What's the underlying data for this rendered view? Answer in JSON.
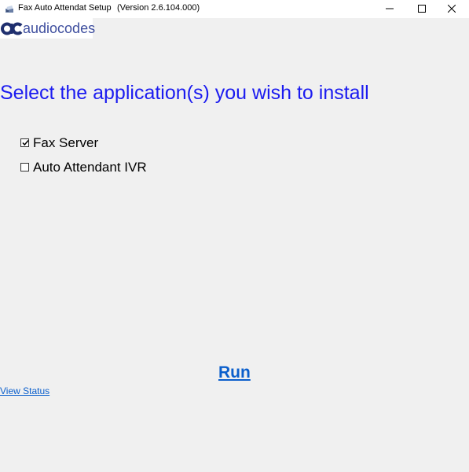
{
  "window": {
    "title": "Fax Auto Attendat Setup",
    "version": "(Version 2.6.104.000)",
    "icons": {
      "app": "fax-app-icon",
      "minimize": "minimize-icon",
      "maximize": "maximize-icon",
      "close": "close-icon"
    }
  },
  "logo": {
    "text": "audiocodes",
    "icon": "audiocodes-logo-mark"
  },
  "main": {
    "heading": "Select the application(s) you wish to install",
    "options": [
      {
        "label": "Fax Server",
        "checked": true
      },
      {
        "label": "Auto Attendant IVR",
        "checked": false
      }
    ],
    "run_label": "Run",
    "status_label": "View Status"
  },
  "colors": {
    "heading": "#1b1bf0",
    "link": "#0b5fcc",
    "logo": "#3e4e9e",
    "background": "#f0f0f0"
  }
}
